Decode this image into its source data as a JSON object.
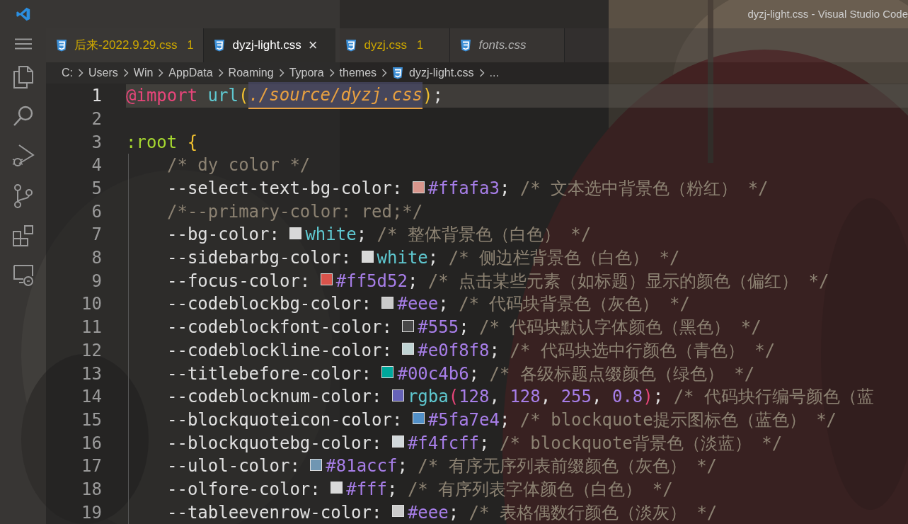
{
  "window": {
    "title": "dyzj-light.css - Visual Studio Code"
  },
  "tabs": [
    {
      "label": "后来-2022.9.29.css",
      "problems": "1",
      "warning": true,
      "preview": false,
      "selected": false
    },
    {
      "label": "dyzj-light.css",
      "close": "×",
      "warning": false,
      "preview": false,
      "selected": true
    },
    {
      "label": "dyzj.css",
      "problems": "1",
      "warning": true,
      "preview": false,
      "selected": false
    },
    {
      "label": "fonts.css",
      "warning": false,
      "preview": true,
      "selected": false
    }
  ],
  "breadcrumb": [
    "C:",
    "Users",
    "Win",
    "AppData",
    "Roaming",
    "Typora",
    "themes",
    "dyzj-light.css",
    "..."
  ],
  "activity_bar": [
    {
      "kind": "menu"
    },
    {
      "kind": "explorer"
    },
    {
      "kind": "search"
    },
    {
      "kind": "debug"
    },
    {
      "kind": "scm"
    },
    {
      "kind": "extensions"
    },
    {
      "kind": "remote"
    }
  ],
  "lines": [
    {
      "number": "1",
      "current": true,
      "tokens": [
        {
          "kind": "at",
          "text": "@import "
        },
        {
          "kind": "func",
          "text": "url"
        },
        {
          "kind": "bracket",
          "text": "("
        },
        {
          "kind": "string",
          "text": "./source/dyzj.css"
        },
        {
          "kind": "bracket",
          "text": ")"
        },
        {
          "kind": "plain",
          "text": ";"
        }
      ]
    },
    {
      "number": "2",
      "current": false
    },
    {
      "number": "3",
      "current": false,
      "tokens": [
        {
          "kind": "selector",
          "text": ":root "
        },
        {
          "kind": "bracket",
          "text": "{"
        }
      ],
      "children": [
        {
          "number": "4",
          "current": false,
          "tokens": [
            {
              "kind": "comment",
              "text": "/* dy color */"
            }
          ]
        },
        {
          "number": "5",
          "current": false,
          "tokens": [
            {
              "kind": "prop",
              "text": "--select-text-bg-color: "
            },
            {
              "kind": "swatch",
              "color": "#d9968d"
            },
            {
              "kind": "num",
              "text": "#ffafa3"
            },
            {
              "kind": "plain",
              "text": "; "
            },
            {
              "kind": "comment",
              "text": "/* 文本选中背景色（粉红） */"
            }
          ]
        },
        {
          "number": "6",
          "current": false,
          "tokens": [
            {
              "kind": "comment",
              "text": "/*--primary-color: red;*/"
            }
          ]
        },
        {
          "number": "7",
          "current": false,
          "tokens": [
            {
              "kind": "prop",
              "text": "--bg-color: "
            },
            {
              "kind": "swatch",
              "color": "#d8d8d8"
            },
            {
              "kind": "keyword",
              "text": "white"
            },
            {
              "kind": "plain",
              "text": "; "
            },
            {
              "kind": "comment",
              "text": "/* 整体背景色（白色） */"
            }
          ]
        },
        {
          "number": "8",
          "current": false,
          "tokens": [
            {
              "kind": "prop",
              "text": "--sidebarbg-color: "
            },
            {
              "kind": "swatch",
              "color": "#d8d8d8"
            },
            {
              "kind": "keyword",
              "text": "white"
            },
            {
              "kind": "plain",
              "text": "; "
            },
            {
              "kind": "comment",
              "text": "/* 侧边栏背景色（白色） */"
            }
          ]
        },
        {
          "number": "9",
          "current": false,
          "tokens": [
            {
              "kind": "prop",
              "text": "--focus-color: "
            },
            {
              "kind": "swatch",
              "color": "#d9534b"
            },
            {
              "kind": "num",
              "text": "#ff5d52"
            },
            {
              "kind": "plain",
              "text": "; "
            },
            {
              "kind": "comment",
              "text": "/* 点击某些元素（如标题）显示的颜色（偏红） */"
            }
          ]
        },
        {
          "number": "10",
          "current": false,
          "tokens": [
            {
              "kind": "prop",
              "text": "--codeblockbg-color: "
            },
            {
              "kind": "swatch",
              "color": "#cacaca"
            },
            {
              "kind": "num",
              "text": "#eee"
            },
            {
              "kind": "plain",
              "text": "; "
            },
            {
              "kind": "comment",
              "text": "/* 代码块背景色（灰色） */"
            }
          ]
        },
        {
          "number": "11",
          "current": false,
          "tokens": [
            {
              "kind": "prop",
              "text": "--codeblockfont-color: "
            },
            {
              "kind": "swatch",
              "color": "#484848"
            },
            {
              "kind": "num",
              "text": "#555"
            },
            {
              "kind": "plain",
              "text": "; "
            },
            {
              "kind": "comment",
              "text": "/* 代码块默认字体颜色（黑色） */"
            }
          ]
        },
        {
          "number": "12",
          "current": false,
          "tokens": [
            {
              "kind": "prop",
              "text": "--codeblockline-color: "
            },
            {
              "kind": "swatch",
              "color": "#bfd3d3"
            },
            {
              "kind": "num",
              "text": "#e0f8f8"
            },
            {
              "kind": "plain",
              "text": "; "
            },
            {
              "kind": "comment",
              "text": "/* 代码块选中行颜色（青色） */"
            }
          ]
        },
        {
          "number": "13",
          "current": false,
          "tokens": [
            {
              "kind": "prop",
              "text": "--titlebefore-color: "
            },
            {
              "kind": "swatch",
              "color": "#00a89c"
            },
            {
              "kind": "num",
              "text": "#00c4b6"
            },
            {
              "kind": "plain",
              "text": "; "
            },
            {
              "kind": "comment",
              "text": "/* 各级标题点缀颜色（绿色） */"
            }
          ]
        },
        {
          "number": "14",
          "current": false,
          "tokens": [
            {
              "kind": "prop",
              "text": "--codeblocknum-color: "
            },
            {
              "kind": "swatch",
              "color": "#6662b8"
            },
            {
              "kind": "func",
              "text": "rgba"
            },
            {
              "kind": "paren",
              "text": "("
            },
            {
              "kind": "num",
              "text": "128"
            },
            {
              "kind": "plain",
              "text": ", "
            },
            {
              "kind": "num",
              "text": "128"
            },
            {
              "kind": "plain",
              "text": ", "
            },
            {
              "kind": "num",
              "text": "255"
            },
            {
              "kind": "plain",
              "text": ", "
            },
            {
              "kind": "num",
              "text": "0.8"
            },
            {
              "kind": "paren",
              "text": ")"
            },
            {
              "kind": "plain",
              "text": "; "
            },
            {
              "kind": "comment",
              "text": "/* 代码块行编号颜色（蓝"
            }
          ]
        },
        {
          "number": "15",
          "current": false,
          "tokens": [
            {
              "kind": "prop",
              "text": "--blockquoteicon-color: "
            },
            {
              "kind": "swatch",
              "color": "#5290c8"
            },
            {
              "kind": "num",
              "text": "#5fa7e4"
            },
            {
              "kind": "plain",
              "text": "; "
            },
            {
              "kind": "comment",
              "text": "/* blockquote提示图标色（蓝色） */"
            }
          ]
        },
        {
          "number": "16",
          "current": false,
          "tokens": [
            {
              "kind": "prop",
              "text": "--blockquotebg-color: "
            },
            {
              "kind": "swatch",
              "color": "#d2d8db"
            },
            {
              "kind": "num",
              "text": "#f4fcff"
            },
            {
              "kind": "plain",
              "text": "; "
            },
            {
              "kind": "comment",
              "text": "/* blockquote背景色（淡蓝） */"
            }
          ]
        },
        {
          "number": "17",
          "current": false,
          "tokens": [
            {
              "kind": "prop",
              "text": "--ulol-color: "
            },
            {
              "kind": "swatch",
              "color": "#7096b2"
            },
            {
              "kind": "num",
              "text": "#81accf"
            },
            {
              "kind": "plain",
              "text": "; "
            },
            {
              "kind": "comment",
              "text": "/* 有序无序列表前缀颜色（灰色） */"
            }
          ]
        },
        {
          "number": "18",
          "current": false,
          "tokens": [
            {
              "kind": "prop",
              "text": "--olfore-color: "
            },
            {
              "kind": "swatch",
              "color": "#dadada"
            },
            {
              "kind": "num",
              "text": "#fff"
            },
            {
              "kind": "plain",
              "text": "; "
            },
            {
              "kind": "comment",
              "text": "/* 有序列表字体颜色（白色） */"
            }
          ]
        },
        {
          "number": "19",
          "current": false,
          "tokens": [
            {
              "kind": "prop",
              "text": "--tableevenrow-color: "
            },
            {
              "kind": "swatch",
              "color": "#cbcbcb"
            },
            {
              "kind": "num",
              "text": "#eee"
            },
            {
              "kind": "plain",
              "text": "; "
            },
            {
              "kind": "comment",
              "text": "/* 表格偶数行颜色（淡灰） */"
            }
          ]
        }
      ]
    }
  ]
}
